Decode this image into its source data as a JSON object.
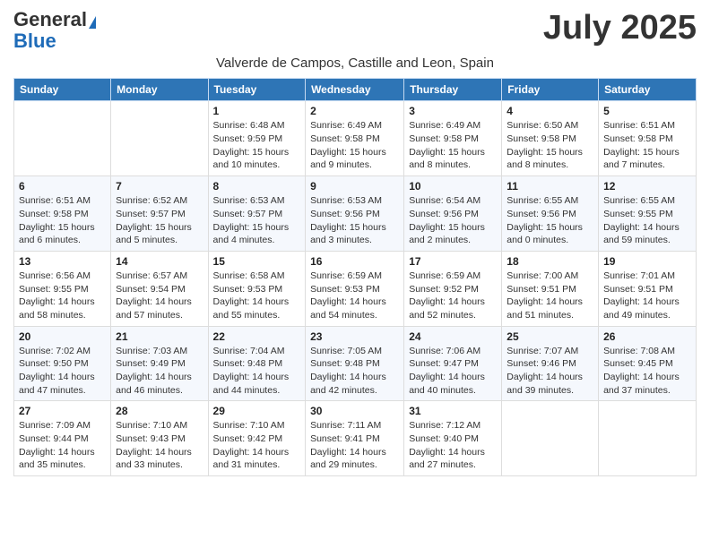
{
  "header": {
    "logo_general": "General",
    "logo_blue": "Blue",
    "month_title": "July 2025",
    "location": "Valverde de Campos, Castille and Leon, Spain"
  },
  "days_of_week": [
    "Sunday",
    "Monday",
    "Tuesday",
    "Wednesday",
    "Thursday",
    "Friday",
    "Saturday"
  ],
  "weeks": [
    [
      {
        "day": "",
        "info": ""
      },
      {
        "day": "",
        "info": ""
      },
      {
        "day": "1",
        "info": "Sunrise: 6:48 AM\nSunset: 9:59 PM\nDaylight: 15 hours and 10 minutes."
      },
      {
        "day": "2",
        "info": "Sunrise: 6:49 AM\nSunset: 9:58 PM\nDaylight: 15 hours and 9 minutes."
      },
      {
        "day": "3",
        "info": "Sunrise: 6:49 AM\nSunset: 9:58 PM\nDaylight: 15 hours and 8 minutes."
      },
      {
        "day": "4",
        "info": "Sunrise: 6:50 AM\nSunset: 9:58 PM\nDaylight: 15 hours and 8 minutes."
      },
      {
        "day": "5",
        "info": "Sunrise: 6:51 AM\nSunset: 9:58 PM\nDaylight: 15 hours and 7 minutes."
      }
    ],
    [
      {
        "day": "6",
        "info": "Sunrise: 6:51 AM\nSunset: 9:58 PM\nDaylight: 15 hours and 6 minutes."
      },
      {
        "day": "7",
        "info": "Sunrise: 6:52 AM\nSunset: 9:57 PM\nDaylight: 15 hours and 5 minutes."
      },
      {
        "day": "8",
        "info": "Sunrise: 6:53 AM\nSunset: 9:57 PM\nDaylight: 15 hours and 4 minutes."
      },
      {
        "day": "9",
        "info": "Sunrise: 6:53 AM\nSunset: 9:56 PM\nDaylight: 15 hours and 3 minutes."
      },
      {
        "day": "10",
        "info": "Sunrise: 6:54 AM\nSunset: 9:56 PM\nDaylight: 15 hours and 2 minutes."
      },
      {
        "day": "11",
        "info": "Sunrise: 6:55 AM\nSunset: 9:56 PM\nDaylight: 15 hours and 0 minutes."
      },
      {
        "day": "12",
        "info": "Sunrise: 6:55 AM\nSunset: 9:55 PM\nDaylight: 14 hours and 59 minutes."
      }
    ],
    [
      {
        "day": "13",
        "info": "Sunrise: 6:56 AM\nSunset: 9:55 PM\nDaylight: 14 hours and 58 minutes."
      },
      {
        "day": "14",
        "info": "Sunrise: 6:57 AM\nSunset: 9:54 PM\nDaylight: 14 hours and 57 minutes."
      },
      {
        "day": "15",
        "info": "Sunrise: 6:58 AM\nSunset: 9:53 PM\nDaylight: 14 hours and 55 minutes."
      },
      {
        "day": "16",
        "info": "Sunrise: 6:59 AM\nSunset: 9:53 PM\nDaylight: 14 hours and 54 minutes."
      },
      {
        "day": "17",
        "info": "Sunrise: 6:59 AM\nSunset: 9:52 PM\nDaylight: 14 hours and 52 minutes."
      },
      {
        "day": "18",
        "info": "Sunrise: 7:00 AM\nSunset: 9:51 PM\nDaylight: 14 hours and 51 minutes."
      },
      {
        "day": "19",
        "info": "Sunrise: 7:01 AM\nSunset: 9:51 PM\nDaylight: 14 hours and 49 minutes."
      }
    ],
    [
      {
        "day": "20",
        "info": "Sunrise: 7:02 AM\nSunset: 9:50 PM\nDaylight: 14 hours and 47 minutes."
      },
      {
        "day": "21",
        "info": "Sunrise: 7:03 AM\nSunset: 9:49 PM\nDaylight: 14 hours and 46 minutes."
      },
      {
        "day": "22",
        "info": "Sunrise: 7:04 AM\nSunset: 9:48 PM\nDaylight: 14 hours and 44 minutes."
      },
      {
        "day": "23",
        "info": "Sunrise: 7:05 AM\nSunset: 9:48 PM\nDaylight: 14 hours and 42 minutes."
      },
      {
        "day": "24",
        "info": "Sunrise: 7:06 AM\nSunset: 9:47 PM\nDaylight: 14 hours and 40 minutes."
      },
      {
        "day": "25",
        "info": "Sunrise: 7:07 AM\nSunset: 9:46 PM\nDaylight: 14 hours and 39 minutes."
      },
      {
        "day": "26",
        "info": "Sunrise: 7:08 AM\nSunset: 9:45 PM\nDaylight: 14 hours and 37 minutes."
      }
    ],
    [
      {
        "day": "27",
        "info": "Sunrise: 7:09 AM\nSunset: 9:44 PM\nDaylight: 14 hours and 35 minutes."
      },
      {
        "day": "28",
        "info": "Sunrise: 7:10 AM\nSunset: 9:43 PM\nDaylight: 14 hours and 33 minutes."
      },
      {
        "day": "29",
        "info": "Sunrise: 7:10 AM\nSunset: 9:42 PM\nDaylight: 14 hours and 31 minutes."
      },
      {
        "day": "30",
        "info": "Sunrise: 7:11 AM\nSunset: 9:41 PM\nDaylight: 14 hours and 29 minutes."
      },
      {
        "day": "31",
        "info": "Sunrise: 7:12 AM\nSunset: 9:40 PM\nDaylight: 14 hours and 27 minutes."
      },
      {
        "day": "",
        "info": ""
      },
      {
        "day": "",
        "info": ""
      }
    ]
  ]
}
